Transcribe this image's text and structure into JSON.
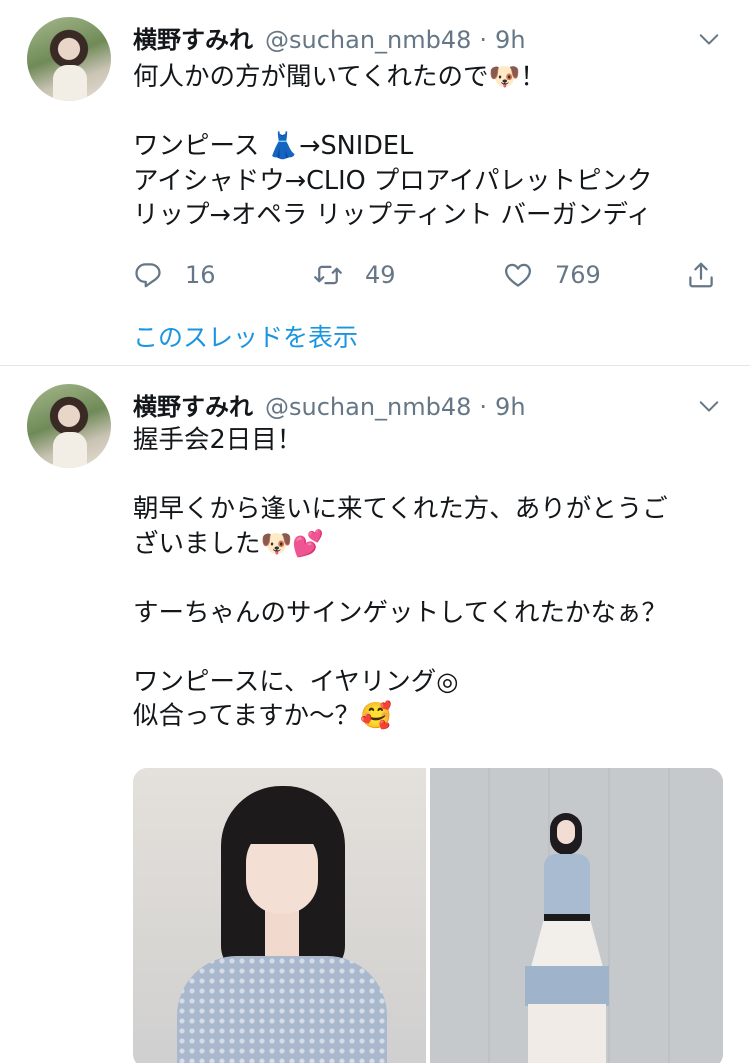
{
  "tweets": [
    {
      "name": "横野すみれ",
      "handle": "@suchan_nmb48",
      "separator": "·",
      "time": "9h",
      "text": "何人かの方が聞いてくれたので🐶！\n\nワンピース 👗→SNIDEL\nアイシャドウ→CLIO プロアイパレットピンク\nリップ→オペラ リップティント バーガンディ",
      "stats": {
        "replies": "16",
        "retweets": "49",
        "likes": "769"
      },
      "thread_link": "このスレッドを表示"
    },
    {
      "name": "横野すみれ",
      "handle": "@suchan_nmb48",
      "separator": "·",
      "time": "9h",
      "text": "握手会2日目！\n\n朝早くから逢いに来てくれた方、ありがとうご\nざいました🐶💕\n\nすーちゃんのサインゲットしてくれたかなぁ？\n\nワンピースに、イヤリング◎\n似合ってますか〜？🥰"
    }
  ],
  "icons": {
    "reply": "reply-icon",
    "retweet": "retweet-icon",
    "like": "heart-icon",
    "share": "share-icon",
    "menu": "chevron-down-icon"
  },
  "colors": {
    "text": "#14171a",
    "secondary": "#657786",
    "link": "#1b95e0",
    "divider": "#e1e8ed"
  }
}
